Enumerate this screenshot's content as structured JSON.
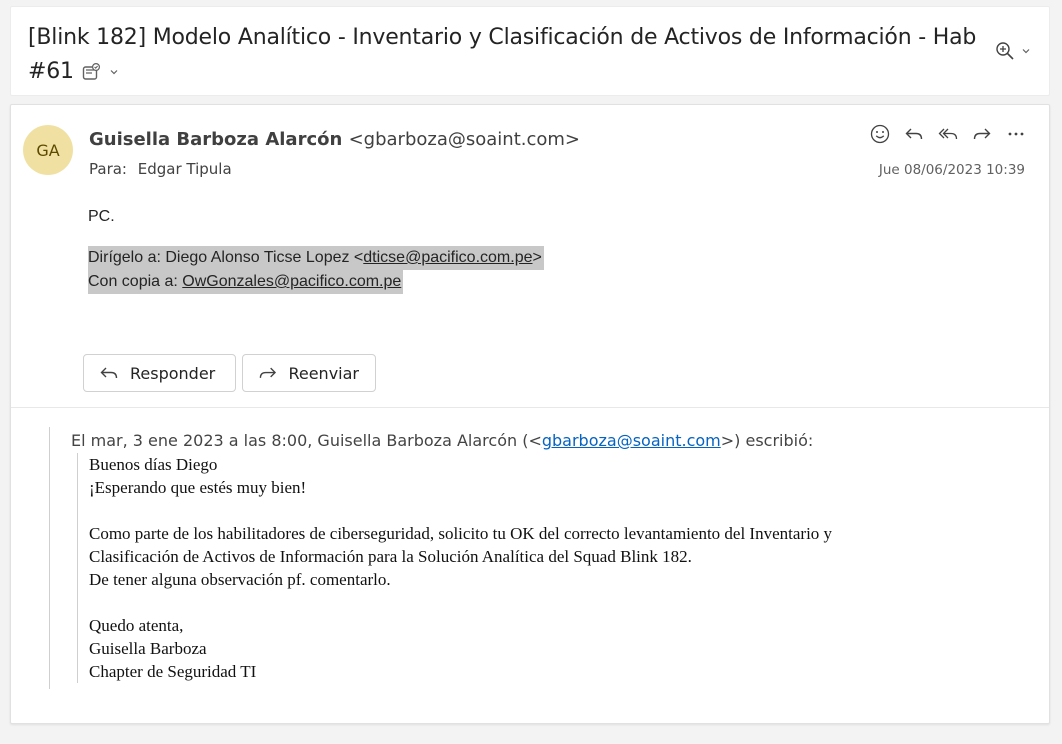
{
  "subject": {
    "title": "[Blink 182] Modelo Analítico - Inventario y Clasificación de Activos de Información - Hab #61"
  },
  "message": {
    "avatar_initials": "GA",
    "sender_name": "Guisella Barboza Alarcón",
    "sender_email": "<gbarboza@soaint.com>",
    "to_label": "Para:",
    "to_name": "Edgar Tipula",
    "date": "Jue 08/06/2023 10:39",
    "body": {
      "pc": "PC.",
      "dirigelo_prefix": "Dirígelo a: Diego Alonso Ticse Lopez <",
      "dirigelo_email": "dticse@pacifico.com.pe",
      "dirigelo_suffix": ">",
      "cc_prefix": "Con copia a: ",
      "cc_email": "OwGonzales@pacifico.com.pe"
    },
    "buttons": {
      "reply": "Responder",
      "forward": "Reenviar"
    }
  },
  "quoted": {
    "header_prefix": "El mar, 3 ene 2023 a las 8:00, Guisella Barboza Alarcón (<",
    "header_email": "gbarboza@soaint.com",
    "header_suffix": ">) escribió:",
    "lines": [
      "Buenos días Diego",
      "¡Esperando que estés muy bien!",
      "",
      "Como parte de los habilitadores de ciberseguridad, solicito tu OK del correcto levantamiento del Inventario y",
      "Clasificación de Activos de Información para la Solución Analítica del Squad Blink 182.",
      "De tener alguna observación pf. comentarlo.",
      "",
      "Quedo atenta,",
      "Guisella Barboza",
      "Chapter de Seguridad TI"
    ]
  },
  "colors": {
    "avatar_bg": "#f0e1a2",
    "link": "#0563c1",
    "highlight": "#c8c8c8"
  },
  "icons": [
    "tag-icon",
    "chevron-down-icon",
    "zoom-icon",
    "emoji-icon",
    "reply-icon",
    "reply-all-icon",
    "forward-icon",
    "more-icon"
  ]
}
